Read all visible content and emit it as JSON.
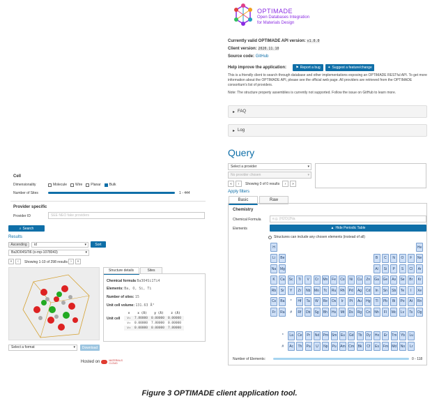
{
  "brand": {
    "title": "OPTIMADE",
    "subtitle_line1": "Open Databases Integration",
    "subtitle_line2": "for Materials Design"
  },
  "info": {
    "version_label": "Currently valid OPTIMADE API version:",
    "version_value": "v1.0.0",
    "client_label": "Client version:",
    "client_value": "2020.11.10",
    "source_label": "Source code:",
    "source_value": "GitHub",
    "help_label": "Help improve the application:",
    "report_bug": "Report a bug",
    "suggest": "Suggest a feature/change",
    "para1": "This is a friendly client to search through database and other implementations exposing an OPTIMADE RESTful API. To get more information about the OPTIMADE API, please see the official web page. All providers are retrieved from the OPTIMADE consortium's list of providers.",
    "note": "Note: The structure property assemblies is currently not supported. Follow the issue on GitHub to learn more."
  },
  "accordions": {
    "faq": "FAQ",
    "log": "Log"
  },
  "query": {
    "title": "Query",
    "provider_select": "Select a provider",
    "database_select": "No provider chosen",
    "showing": "Showing 0 of 0 results",
    "apply_filters": "Apply filters",
    "tab_basic": "Basic",
    "tab_raw": "Raw",
    "chemistry": "Chemistry",
    "chem_formula_label": "Chemical Formula",
    "chem_formula_placeholder": "e.g. (H2O)2Na",
    "elements_label": "Elements",
    "hide_table": "Hide Periodic Table",
    "include_other": "Structures can include any chosen elements (instead of all)",
    "num_elements_label": "Number of Elements:",
    "num_elements_value": "0 - 118"
  },
  "elements": {
    "rows": [
      [
        "H",
        "",
        "",
        "",
        "",
        "",
        "",
        "",
        "",
        "",
        "",
        "",
        "",
        "",
        "",
        "",
        "",
        "He"
      ],
      [
        "Li",
        "Be",
        "",
        "",
        "",
        "",
        "",
        "",
        "",
        "",
        "",
        "",
        "B",
        "C",
        "N",
        "O",
        "F",
        "Ne"
      ],
      [
        "Na",
        "Mg",
        "",
        "",
        "",
        "",
        "",
        "",
        "",
        "",
        "",
        "",
        "Al",
        "Si",
        "P",
        "S",
        "Cl",
        "Ar"
      ],
      [
        "K",
        "Ca",
        "Sc",
        "Ti",
        "V",
        "Cr",
        "Mn",
        "Fe",
        "Co",
        "Ni",
        "Cu",
        "Zn",
        "Ga",
        "Ge",
        "As",
        "Se",
        "Br",
        "Kr"
      ],
      [
        "Rb",
        "Sr",
        "Y",
        "Zr",
        "Nb",
        "Mo",
        "Tc",
        "Ru",
        "Rh",
        "Pd",
        "Ag",
        "Cd",
        "In",
        "Sn",
        "Sb",
        "Te",
        "I",
        "Xe"
      ],
      [
        "Cs",
        "Ba",
        "*",
        "Hf",
        "Ta",
        "W",
        "Re",
        "Os",
        "Ir",
        "Pt",
        "Au",
        "Hg",
        "Tl",
        "Pb",
        "Bi",
        "Po",
        "At",
        "Rn"
      ],
      [
        "Fr",
        "Ra",
        "#",
        "Rf",
        "Db",
        "Sg",
        "Bh",
        "Hs",
        "Mt",
        "Ds",
        "Rg",
        "Cn",
        "Nh",
        "Fl",
        "Mc",
        "Lv",
        "Ts",
        "Og"
      ]
    ],
    "lanthanides": [
      "*",
      "La",
      "Ce",
      "Pr",
      "Nd",
      "Pm",
      "Sm",
      "Eu",
      "Gd",
      "Tb",
      "Dy",
      "Ho",
      "Er",
      "Tm",
      "Yb",
      "Lu"
    ],
    "actinides": [
      "#",
      "Ac",
      "Th",
      "Pa",
      "U",
      "Np",
      "Pu",
      "Am",
      "Cm",
      "Bk",
      "Cf",
      "Es",
      "Fm",
      "Md",
      "No",
      "Lr"
    ]
  },
  "left": {
    "cell": "Cell",
    "dimensionality": "Dimensionality",
    "molecule": "Molecule",
    "wire": "Wire",
    "planar": "Planar",
    "bulk": "Bulk",
    "num_sites": "Number of Sites",
    "num_sites_range": "1 - 444",
    "provider_specific": "Provider specific",
    "provider_id": "Provider ID",
    "provider_id_placeholder": "SEE NEO fake providers",
    "search": "Search",
    "results": "Results",
    "ascending": "Ascending",
    "sort_field": "id",
    "sort": "Sort",
    "result_select": "Ba3O04SiTi6 (o-mp-1078043)",
    "showing": "Showing 1-10 of 298 results",
    "tab_structure": "Structure details",
    "tab_sites": "Sites",
    "chem_formula_label": "Chemical formula",
    "chem_formula_value": "Ba3O4Si1Ti4",
    "elements_label": "Elements:",
    "elements_value": "Ba, O, Si, Ti",
    "num_sites_label": "Number of sites:",
    "num_sites_value": "15",
    "volume_label": "Unit cell volume:",
    "volume_value": "131.63 Å³",
    "unit_cell_label": "Unit cell",
    "cols": [
      "v",
      "x (Å)",
      "y (Å)",
      "z (Å)"
    ],
    "rows": [
      [
        "v₁",
        "7.80000",
        "0.00000",
        "0.00000"
      ],
      [
        "v₂",
        "0.00000",
        "7.80000",
        "0.00000"
      ],
      [
        "v₃",
        "0.00000",
        "0.00000",
        "7.80000"
      ]
    ],
    "format_select": "Select a format",
    "download": "Download",
    "hosted_on": "Hosted on",
    "materials_cloud": "MATERIALS CLOUD"
  },
  "caption": "Figure 3 OPTIMADE client application tool."
}
